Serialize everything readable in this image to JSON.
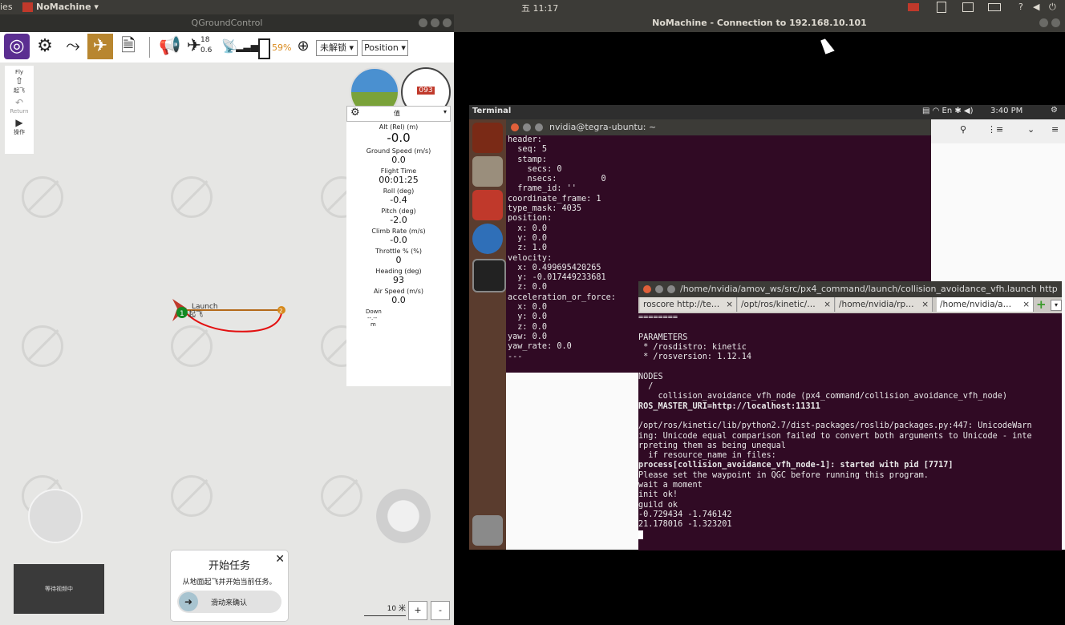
{
  "topbar": {
    "left_cut": "ies",
    "app": "NoMachine ▾",
    "clock": "五 11:17"
  },
  "qgc": {
    "window_title": "QGroundControl",
    "toolbar": {
      "satellites": "18",
      "hdop": "0.6",
      "battery": "59%",
      "arm_state": "未解锁 ▾",
      "mode": "Position ▾"
    },
    "left_strip": {
      "fly": "Fly",
      "takeoff": "起飞",
      "return": "Return",
      "action": "操作"
    },
    "compass_heading": "093",
    "instrument_panel": {
      "header": "值",
      "items": [
        {
          "label": "Alt (Rel) (m)",
          "value": "-0.0"
        },
        {
          "label": "Ground Speed (m/s)",
          "value": "0.0"
        },
        {
          "label": "Flight Time",
          "value": "00:01:25"
        },
        {
          "label": "Roll (deg)",
          "value": "-0.4"
        },
        {
          "label": "Pitch (deg)",
          "value": "-2.0"
        },
        {
          "label": "Climb Rate (m/s)",
          "value": "-0.0"
        },
        {
          "label": "Throttle % (%)",
          "value": "0"
        },
        {
          "label": "Heading (deg)",
          "value": "93"
        },
        {
          "label": "Air Speed (m/s)",
          "value": "0.0"
        }
      ],
      "down_label": "Down",
      "down_value": "--.--",
      "down_unit": "m"
    },
    "map": {
      "launch_label": "Launch",
      "takeoff_label": "起飞",
      "wp1": "1",
      "wp2": "2",
      "scale": "10 米",
      "zoom_in": "+",
      "zoom_out": "-"
    },
    "video": {
      "text": "等待视频中"
    },
    "mission_popup": {
      "title": "开始任务",
      "desc": "从地面起飞并开始当前任务。",
      "slider": "滑动来确认",
      "close": "✕"
    }
  },
  "nomachine": {
    "window_title": "NoMachine - Connection to 192.168.10.101",
    "remote_topbar": {
      "app": "Terminal",
      "time": "3:40 PM"
    },
    "term1": {
      "title": "nvidia@tegra-ubuntu: ~",
      "lines": "header:\n  seq: 5\n  stamp:\n    secs: 0\n    nsecs:         0\n  frame_id: ''\ncoordinate_frame: 1\ntype_mask: 4035\nposition:\n  x: 0.0\n  y: 0.0\n  z: 1.0\nvelocity:\n  x: 0.499695420265\n  y: -0.017449233681\n  z: 0.0\nacceleration_or_force:\n  x: 0.0\n  y: 0.0\n  z: 0.0\nyaw: 0.0\nyaw_rate: 0.0\n---"
    },
    "term2": {
      "title": "/home/nvidia/amov_ws/src/px4_command/launch/collision_avoidance_vfh.launch http://l",
      "tabs": [
        "roscore http://te…",
        "/opt/ros/kinetic/…",
        "/home/nvidia/rp…",
        "/home/nvidia/a…"
      ],
      "lines_a": "========\n\nPARAMETERS\n * /rosdistro: kinetic\n * /rosversion: 1.12.14\n\nNODES\n  /\n    collision_avoidance_vfh_node (px4_command/collision_avoidance_vfh_node)\n",
      "bold_uri": "ROS_MASTER_URI=http://localhost:11311",
      "lines_b": "\n/opt/ros/kinetic/lib/python2.7/dist-packages/roslib/packages.py:447: UnicodeWarn\ning: Unicode equal comparison failed to convert both arguments to Unicode - inte\nrpreting them as being unequal\n  if resource_name in files:",
      "bold_process": "process[collision_avoidance_vfh_node-1]: started with pid [7717]",
      "lines_c": "Please set the waypoint in QGC before running this program.\nwait a moment\ninit ok!\nguild ok\n-0.729434 -1.746142\n21.178016 -1.323201"
    }
  }
}
